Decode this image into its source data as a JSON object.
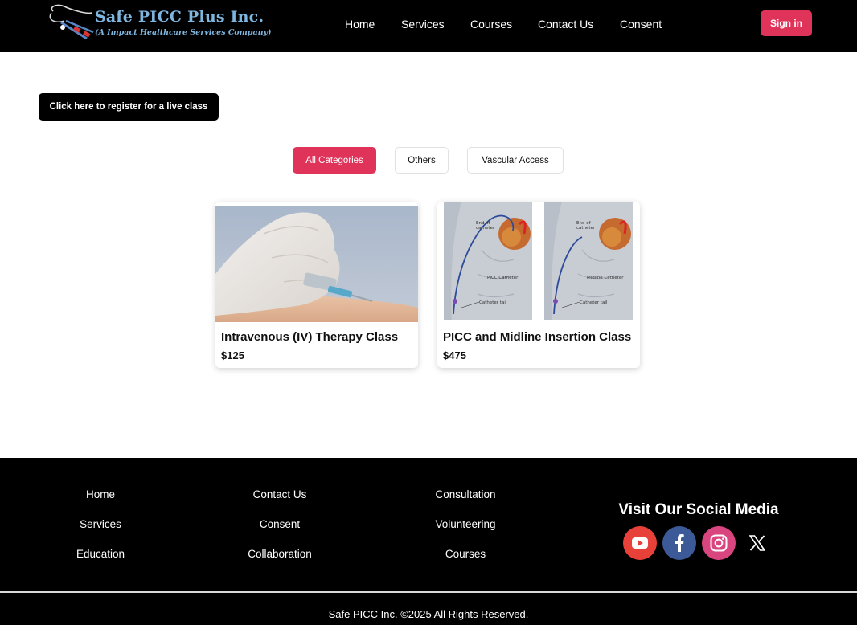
{
  "header": {
    "logo_title": "Safe PICC Plus Inc.",
    "logo_subtitle": "(A Impact Healthcare Services Company)",
    "nav": [
      "Home",
      "Services",
      "Courses",
      "Contact Us",
      "Consent"
    ],
    "signin_label": "Sign in"
  },
  "register_label": "Click here to register for a live class",
  "categories": [
    "All Categories",
    "Others",
    "Vascular Access"
  ],
  "courses": [
    {
      "title": "Intravenous (IV) Therapy Class",
      "price": "$125"
    },
    {
      "title": "PICC and Midline Insertion Class",
      "price": "$475"
    }
  ],
  "picc_labels": {
    "end_of_catheter": "End of catheter",
    "picc_catheter": "PICC Catheter",
    "midline_catheter": "Midline Catheter",
    "catheter_tail": "Catheter tail"
  },
  "footer": {
    "col1": [
      "Home",
      "Services",
      "Education"
    ],
    "col2": [
      "Contact Us",
      "Consent",
      "Collaboration"
    ],
    "col3": [
      "Consultation",
      "Volunteering",
      "Courses"
    ],
    "social_title": "Visit Our Social Media",
    "social_icons": [
      "youtube-icon",
      "facebook-icon",
      "instagram-icon",
      "x-icon"
    ],
    "copyright": "Safe PICC Inc. ©2025 All Rights Reserved."
  },
  "colors": {
    "accent": "#e0335a",
    "youtube": "#e8413a",
    "facebook": "#3d5a98",
    "instagram": "#d9457f"
  }
}
